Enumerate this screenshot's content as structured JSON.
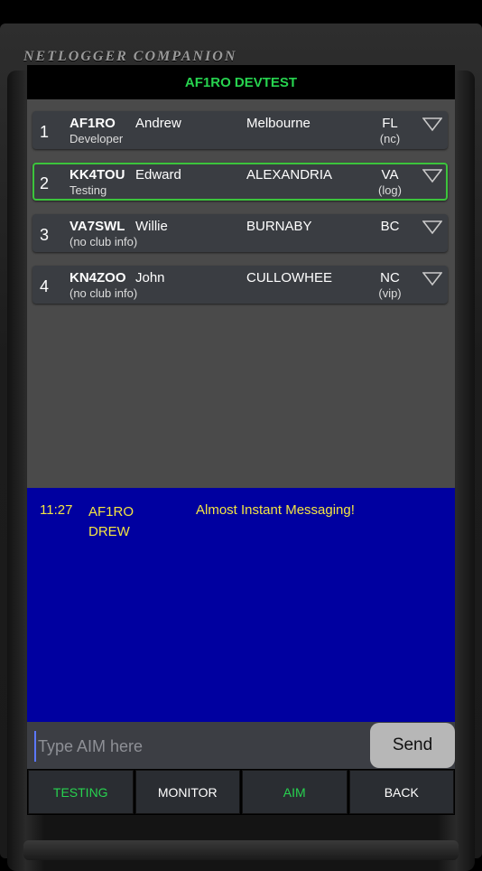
{
  "app": {
    "frame_title": "NETLOGGER COMPANION",
    "net_name": "AF1RO DEVTEST"
  },
  "roster": [
    {
      "num": "1",
      "call": "AF1RO",
      "name": "Andrew",
      "city": "Melbourne",
      "state": "FL",
      "club": "Developer",
      "status": "(nc)",
      "selected": false
    },
    {
      "num": "2",
      "call": "KK4TOU",
      "name": "Edward",
      "city": "ALEXANDRIA",
      "state": "VA",
      "club": "Testing",
      "status": "(log)",
      "selected": true
    },
    {
      "num": "3",
      "call": "VA7SWL",
      "name": "Willie",
      "city": "BURNABY",
      "state": "BC",
      "club": "(no club info)",
      "status": "",
      "selected": false
    },
    {
      "num": "4",
      "call": "KN4ZOO",
      "name": "John",
      "city": "CULLOWHEE",
      "state": "NC",
      "club": "(no club info)",
      "status": "(vip)",
      "selected": false
    }
  ],
  "aim": {
    "messages": [
      {
        "time": "11:27",
        "from_call": "AF1RO",
        "from_name": "DREW",
        "text": "Almost Instant Messaging!"
      }
    ],
    "input_placeholder": "Type AIM here",
    "input_value": "",
    "send_label": "Send"
  },
  "tabs": [
    {
      "label": "TESTING",
      "color": "#27d34f"
    },
    {
      "label": "MONITOR",
      "color": "#ffffff"
    },
    {
      "label": "AIM",
      "color": "#27d34f"
    },
    {
      "label": "BACK",
      "color": "#ffffff"
    }
  ],
  "colors": {
    "header_text": "#27d34f",
    "aim_background": "#0000a0",
    "aim_text": "#f3e442",
    "selected_border": "#3cc43c"
  },
  "icons": {
    "row_menu": "triangle-down-icon"
  }
}
